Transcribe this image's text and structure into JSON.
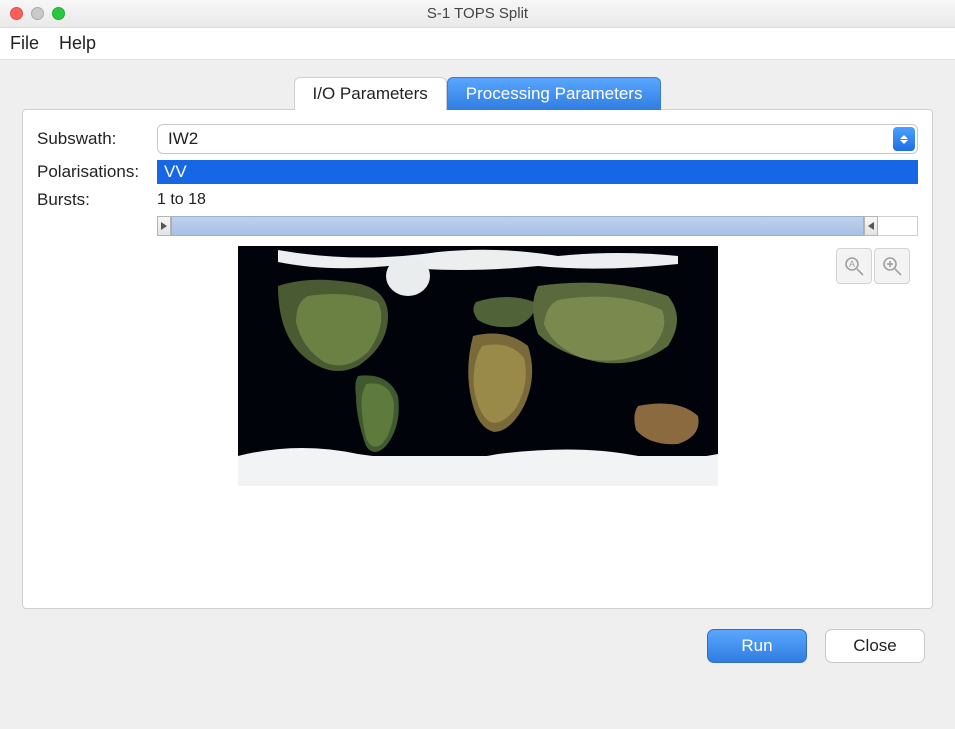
{
  "window": {
    "title": "S-1 TOPS Split"
  },
  "menubar": {
    "file": "File",
    "help": "Help"
  },
  "tabs": {
    "io": "I/O Parameters",
    "processing": "Processing Parameters",
    "active": "processing"
  },
  "form": {
    "subswath_label": "Subswath:",
    "subswath_value": "IW2",
    "polarisations_label": "Polarisations:",
    "polarisations_value": "VV",
    "bursts_label": "Bursts:",
    "bursts_value": "1 to 18"
  },
  "buttons": {
    "run": "Run",
    "close": "Close"
  }
}
